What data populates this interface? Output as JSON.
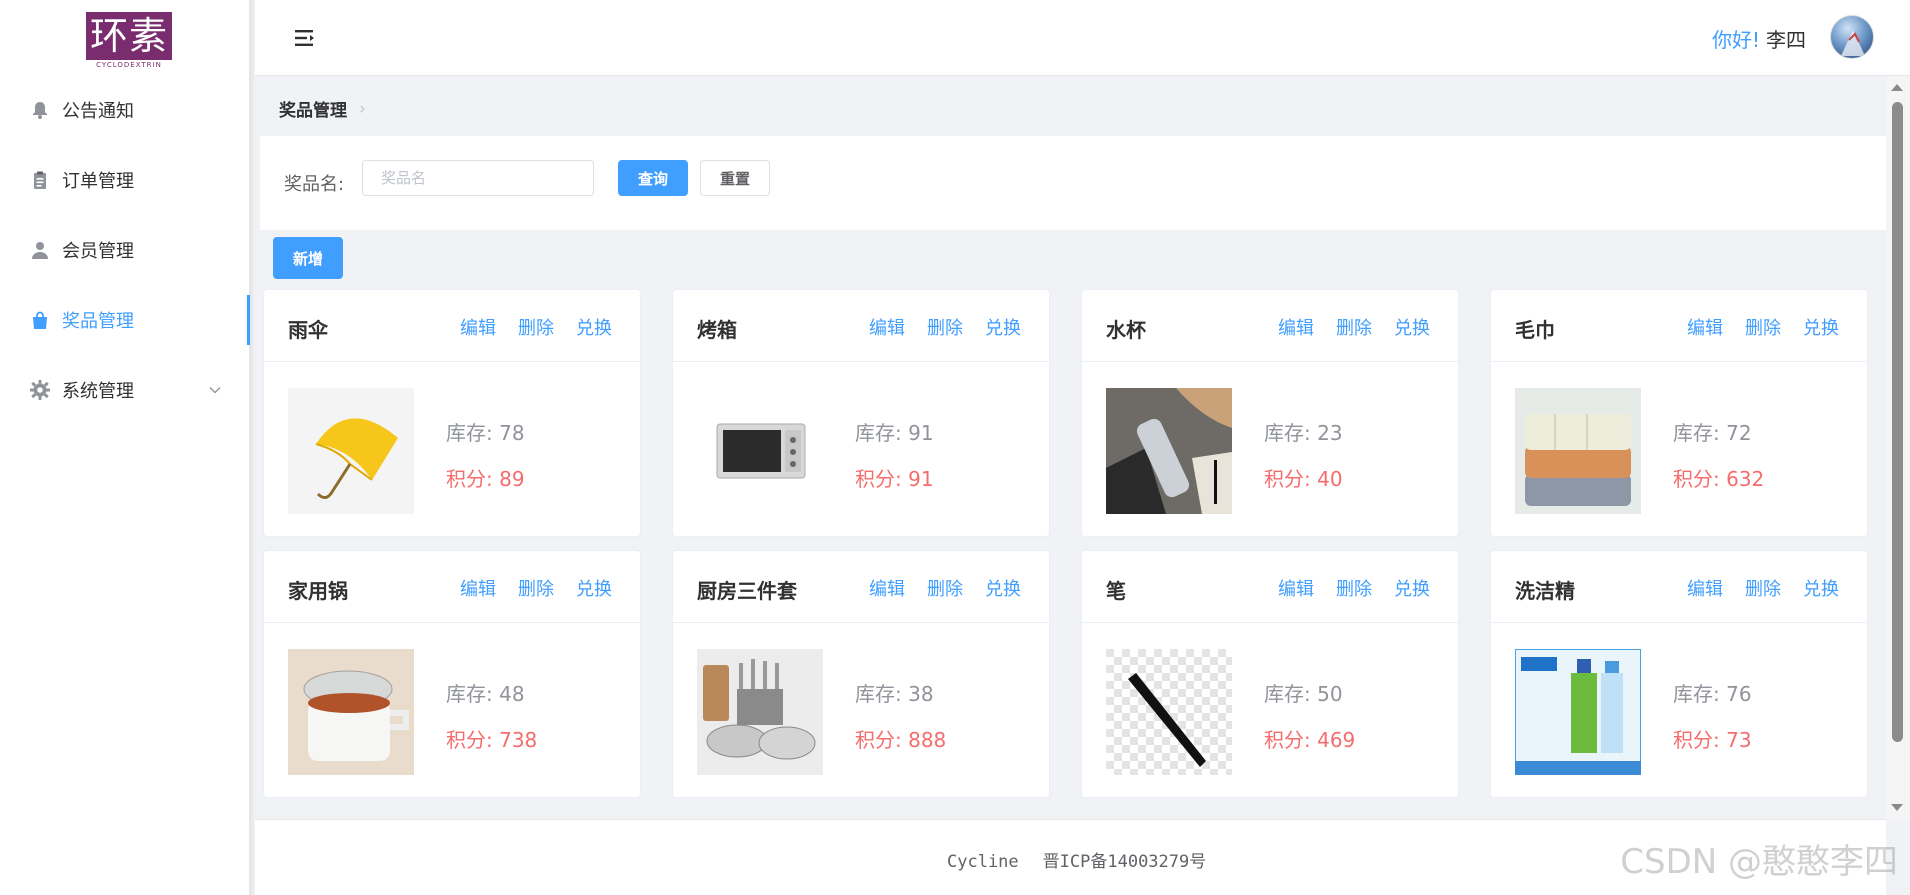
{
  "logo": {
    "text": "环素",
    "subtitle": "CYCLODEXTRIN"
  },
  "sidebar": {
    "items": [
      {
        "label": "公告通知",
        "icon": "bell-icon"
      },
      {
        "label": "订单管理",
        "icon": "clipboard-icon"
      },
      {
        "label": "会员管理",
        "icon": "user-icon"
      },
      {
        "label": "奖品管理",
        "icon": "shopping-bag-icon",
        "active": true
      },
      {
        "label": "系统管理",
        "icon": "gear-icon",
        "expandable": true
      }
    ]
  },
  "header": {
    "greeting": "你好!",
    "username": "李四"
  },
  "breadcrumb": {
    "current": "奖品管理",
    "separator": "›"
  },
  "search": {
    "label": "奖品名:",
    "placeholder": "奖品名",
    "value": "",
    "query_label": "查询",
    "reset_label": "重置"
  },
  "toolbar": {
    "add_label": "新增"
  },
  "card_actions": {
    "edit": "编辑",
    "delete": "删除",
    "exchange": "兑换"
  },
  "labels": {
    "stock_prefix": "库存: ",
    "points_prefix": "积分: "
  },
  "prizes": [
    {
      "name": "雨伞",
      "stock": "78",
      "points": "89",
      "image": "umbrella"
    },
    {
      "name": "烤箱",
      "stock": "91",
      "points": "91",
      "image": "oven"
    },
    {
      "name": "水杯",
      "stock": "23",
      "points": "40",
      "image": "water-bottle"
    },
    {
      "name": "毛巾",
      "stock": "72",
      "points": "632",
      "image": "towels"
    },
    {
      "name": "家用锅",
      "stock": "48",
      "points": "738",
      "image": "pot"
    },
    {
      "name": "厨房三件套",
      "stock": "38",
      "points": "888",
      "image": "cookware-set"
    },
    {
      "name": "笔",
      "stock": "50",
      "points": "469",
      "image": "pen"
    },
    {
      "name": "洗洁精",
      "stock": "76",
      "points": "73",
      "image": "detergent"
    }
  ],
  "footer": {
    "brand": "Cycline",
    "icp": "晋ICP备14003279号"
  },
  "watermark": "CSDN @憨憨李四",
  "colors": {
    "primary": "#409eff",
    "danger": "#f56c6c",
    "muted": "#909399",
    "brand": "#7a2d6e"
  }
}
